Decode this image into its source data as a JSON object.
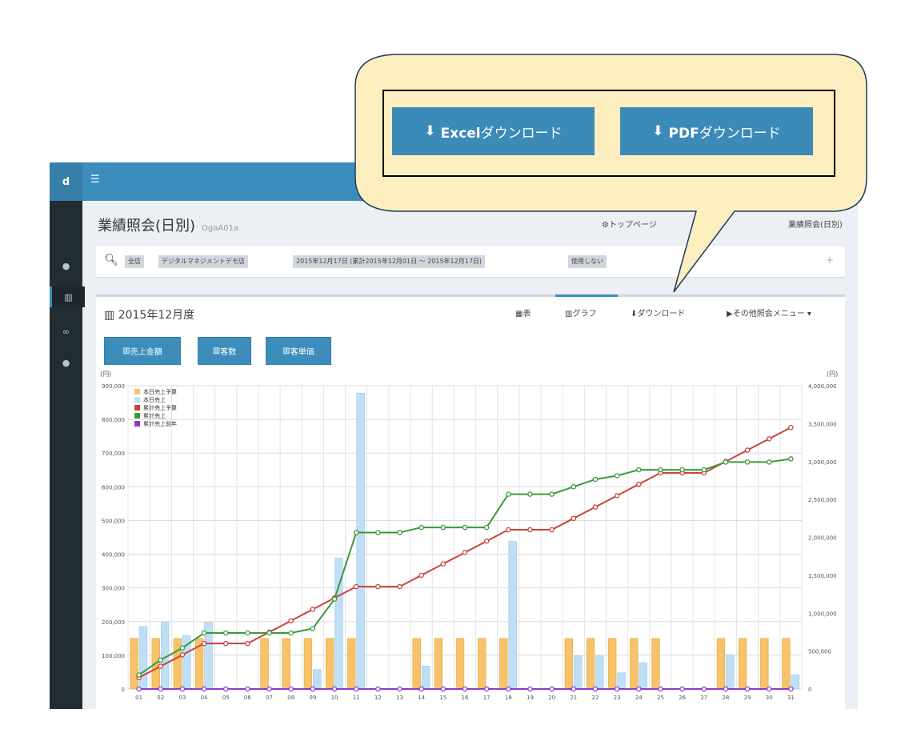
{
  "app": {
    "brand": "d",
    "menu_icon": "hamburger-icon",
    "sidebar_icons": [
      "gear-icon",
      "chart-icon",
      "link-icon",
      "gear-icon"
    ]
  },
  "page": {
    "title": "業績照会(日別)",
    "subtitle": "OgaA01a",
    "breadcrumb_home": "トップページ",
    "breadcrumb_current": "業績照会(日別)"
  },
  "filter": {
    "tags": [
      "全店",
      "デジタルマネジメントデモ店",
      "2015年12月17日 (累計2015年12月01日 ～ 2015年12月17日)",
      "使用しない"
    ],
    "add": "+"
  },
  "panel": {
    "title": "2015年12月度",
    "tabs": [
      "表",
      "グラフ",
      "ダウンロード",
      "その他照会メニュー"
    ]
  },
  "chart_buttons": [
    "売上金額",
    "客数",
    "客単価"
  ],
  "callout": {
    "excel_strong": "Excel",
    "excel_rest": "ダウンロード",
    "pdf_strong": "PDF",
    "pdf_rest": "ダウンロード"
  },
  "colors": {
    "accent": "#3c8dbc",
    "callout_fill": "#fdeec0",
    "budget_bar": "#f6c26b",
    "actual_bar": "#bfdff7",
    "cum_budget": "#c9433c",
    "cum_actual": "#3a9a3a",
    "cum_prev": "#8a3ad0"
  },
  "chart_data": {
    "type": "bar",
    "left_unit": "(円)",
    "right_unit": "(円)",
    "left_ylim": [
      0,
      900000
    ],
    "right_ylim": [
      0,
      4000000
    ],
    "left_ticks": [
      "0",
      "100,000",
      "200,000",
      "300,000",
      "400,000",
      "500,000",
      "600,000",
      "700,000",
      "800,000",
      "900,000"
    ],
    "right_ticks": [
      "0",
      "500,000",
      "1,000,000",
      "1,500,000",
      "2,000,000",
      "2,500,000",
      "3,000,000",
      "3,500,000",
      "4,000,000"
    ],
    "categories": [
      "01",
      "02",
      "03",
      "04",
      "05",
      "06",
      "07",
      "08",
      "09",
      "10",
      "11",
      "12",
      "13",
      "14",
      "15",
      "16",
      "17",
      "18",
      "19",
      "20",
      "21",
      "22",
      "23",
      "24",
      "25",
      "26",
      "27",
      "28",
      "29",
      "30",
      "31"
    ],
    "grid": true,
    "legend_position": "top-left",
    "series": [
      {
        "name": "本日売上予算",
        "kind": "bar",
        "axis": "left",
        "values": [
          150000,
          150000,
          150000,
          150000,
          0,
          0,
          150000,
          150000,
          150000,
          150000,
          150000,
          0,
          0,
          150000,
          150000,
          150000,
          150000,
          150000,
          0,
          0,
          150000,
          150000,
          150000,
          150000,
          150000,
          0,
          0,
          150000,
          150000,
          150000,
          150000
        ]
      },
      {
        "name": "本日売上",
        "kind": "bar",
        "axis": "left",
        "values": [
          185000,
          198000,
          158000,
          198000,
          0,
          0,
          0,
          0,
          58000,
          388000,
          878000,
          0,
          0,
          68000,
          0,
          0,
          0,
          438000,
          0,
          0,
          98000,
          98000,
          48000,
          78000,
          0,
          0,
          0,
          102000,
          0,
          0,
          42000
        ]
      },
      {
        "name": "累計売上予算",
        "kind": "line",
        "axis": "right",
        "values": [
          150000,
          300000,
          450000,
          600000,
          600000,
          600000,
          750000,
          900000,
          1050000,
          1200000,
          1350000,
          1350000,
          1350000,
          1500000,
          1650000,
          1800000,
          1950000,
          2100000,
          2100000,
          2100000,
          2250000,
          2400000,
          2550000,
          2700000,
          2850000,
          2850000,
          2850000,
          3000000,
          3150000,
          3300000,
          3450000
        ]
      },
      {
        "name": "累計売上",
        "kind": "line",
        "axis": "right",
        "values": [
          185000,
          383000,
          541000,
          739000,
          739000,
          739000,
          739000,
          739000,
          797000,
          1185000,
          2063000,
          2063000,
          2063000,
          2131000,
          2131000,
          2131000,
          2131000,
          2569000,
          2569000,
          2569000,
          2667000,
          2765000,
          2813000,
          2891000,
          2891000,
          2891000,
          2891000,
          2993000,
          2993000,
          2993000,
          3035000
        ]
      },
      {
        "name": "累計売上前年",
        "kind": "line",
        "axis": "right",
        "values": [
          0,
          0,
          0,
          0,
          0,
          0,
          0,
          0,
          0,
          0,
          0,
          0,
          0,
          0,
          0,
          0,
          0,
          0,
          0,
          0,
          0,
          0,
          0,
          0,
          0,
          0,
          0,
          0,
          0,
          0,
          0
        ]
      }
    ]
  }
}
